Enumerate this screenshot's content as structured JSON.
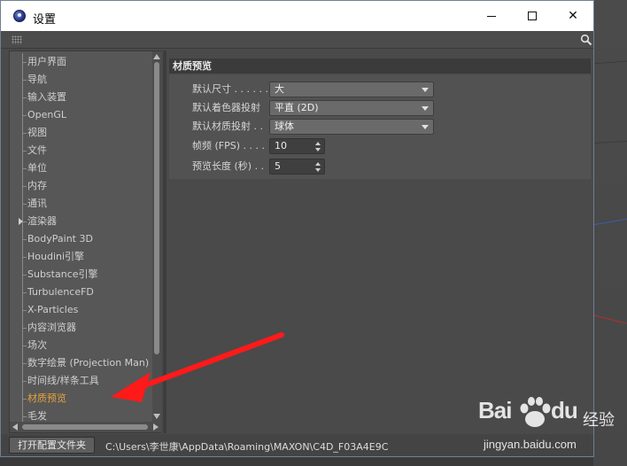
{
  "window": {
    "title": "设置",
    "minimize_icon": "minimize-icon",
    "maximize_icon": "maximize-icon",
    "close_glyph": "✕"
  },
  "sidebar": {
    "items": [
      {
        "label": "用户界面"
      },
      {
        "label": "导航"
      },
      {
        "label": "输入装置"
      },
      {
        "label": "OpenGL"
      },
      {
        "label": "视图"
      },
      {
        "label": "文件"
      },
      {
        "label": "单位"
      },
      {
        "label": "内存"
      },
      {
        "label": "通讯"
      },
      {
        "label": "渲染器",
        "expandable": true
      },
      {
        "label": "BodyPaint 3D"
      },
      {
        "label": "Houdini引擎"
      },
      {
        "label": "Substance引擎"
      },
      {
        "label": "TurbulenceFD"
      },
      {
        "label": "X-Particles"
      },
      {
        "label": "内容浏览器"
      },
      {
        "label": "场次"
      },
      {
        "label": "数字绘景 (Projection Man)"
      },
      {
        "label": "时间线/样条工具"
      },
      {
        "label": "材质预览",
        "active": true
      },
      {
        "label": "毛发"
      }
    ],
    "active_color": "#e8a33d"
  },
  "panel": {
    "section_title": "材质预览",
    "fields": [
      {
        "label": "默认尺寸 . . . . . .",
        "value": "大",
        "kind": "dropdown"
      },
      {
        "label": "默认着色器投射",
        "value": "平直 (2D)",
        "kind": "dropdown"
      },
      {
        "label": "默认材质投射 . .",
        "value": "球体",
        "kind": "dropdown"
      },
      {
        "label": "帧频 (FPS) . . . .",
        "value": "10",
        "kind": "spinner"
      },
      {
        "label": "预览长度 (秒) . .",
        "value": "5",
        "kind": "spinner"
      }
    ]
  },
  "statusbar": {
    "open_folder_label": "打开配置文件夹",
    "path": "C:\\Users\\李世康\\AppData\\Roaming\\MAXON\\C4D_F03A4E9C"
  },
  "watermark": {
    "brand": "Bai",
    "brand_suffix": "du",
    "brand_cn": "经验",
    "url": "jingyan.baidu.com"
  },
  "annotation": {
    "arrow_color": "#ff1a1a"
  }
}
